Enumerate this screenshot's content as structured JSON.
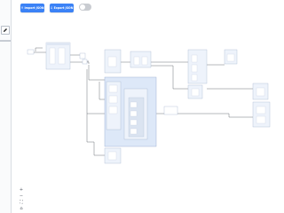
{
  "toolbar": {
    "import_label": "Import JSON",
    "import_icon": "upload-icon",
    "export_label": "Export JSON",
    "export_icon": "download-icon",
    "toggle_state": "off"
  },
  "controls": {
    "zoom_in": "+",
    "zoom_out": "−",
    "fit_view": "⛶",
    "lock": "⌂"
  },
  "colors": {
    "accent": "#3b82f6",
    "node_fill": "#eef3fb",
    "node_border": "#a9b8d3",
    "group_fill": "#dde8f8",
    "edge": "#4a4f57"
  }
}
